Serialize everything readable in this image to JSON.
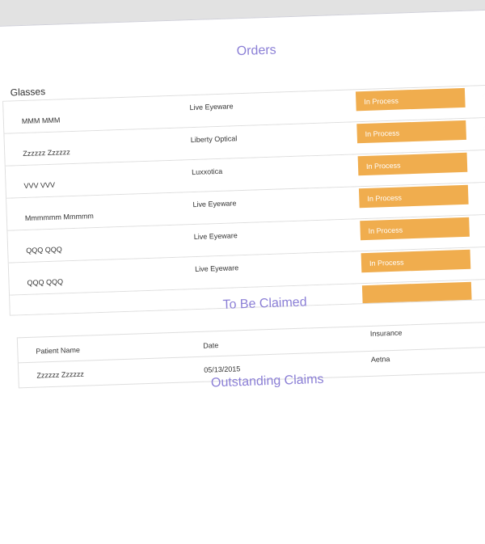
{
  "orders": {
    "title": "Orders",
    "group_label": "Glasses",
    "rows": [
      {
        "patient": "MMM MMM",
        "vendor": "Live Eyeware",
        "status": "In Process"
      },
      {
        "patient": "Zzzzzz Zzzzzz",
        "vendor": "Liberty Optical",
        "status": "In Process"
      },
      {
        "patient": "VVV VVV",
        "vendor": "Luxxotica",
        "status": "In Process"
      },
      {
        "patient": "Mmmmmm Mmmmm",
        "vendor": "Live Eyeware",
        "status": "In Process"
      },
      {
        "patient": "QQQ QQQ",
        "vendor": "Live Eyeware",
        "status": "In Process"
      },
      {
        "patient": "QQQ QQQ",
        "vendor": "Live Eyeware",
        "status": "In Process"
      },
      {
        "patient": "",
        "vendor": "",
        "status": ""
      }
    ]
  },
  "to_be_claimed": {
    "title": "To Be Claimed",
    "columns": [
      "Patient Name",
      "Date",
      "Insurance"
    ],
    "rows": [
      {
        "patient": "Zzzzzz Zzzzzz",
        "date": "05/13/2015",
        "insurance": "Aetna"
      }
    ]
  },
  "outstanding_claims": {
    "title": "Outstanding Claims"
  },
  "colors": {
    "accent": "#8b7fd6",
    "status_in_process": "#f0ad4e",
    "top_bar": "#e2e2e2"
  }
}
